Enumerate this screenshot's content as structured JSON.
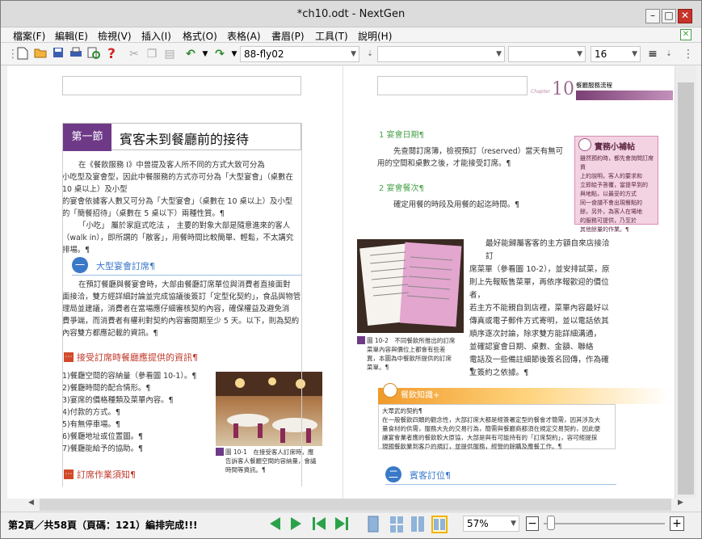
{
  "window": {
    "title": "*ch10.odt - NextGen"
  },
  "menu": [
    "檔案(F)",
    "編輯(E)",
    "檢視(V)",
    "插入(I)",
    "格式(O)",
    "表格(A)",
    "書眉(P)",
    "工具(T)",
    "說明(H)"
  ],
  "toolbar": {
    "style_value": "88-fly02",
    "font_size": "16"
  },
  "status": {
    "text": "第2頁／共58頁（頁碼：121）編排完成!!!",
    "zoom": "57%"
  },
  "left_page": {
    "section_num": "第一節",
    "section_title": "賓客未到餐廳前的接待",
    "para1": [
      "在《餐飲服務 I》中曾提及客人所不同的方式大致可分為",
      "小吃型及宴會型，因此中餐服務的方式亦可分為「大型宴會」（桌數在 10 桌以上）及小型",
      "的宴會依據客人數又可分為「大型宴會」（桌數在 10 桌以上）及小型",
      "的「簡餐招待」（桌數在 5 桌以下）兩種性質。¶",
      "「小吃」 屬於家庭式吃法 ， 主要的對象大部是隨意進來的客人",
      "（walk in），即所謂的「散客」，用餐時間比較簡單、輕鬆，不太講究",
      "排場。¶"
    ],
    "sub1_num": "一",
    "sub1": "大型宴會訂席¶",
    "para2": [
      "在預訂餐廳與餐宴會時，大部由餐廳訂席單位與消費者直接面對",
      "面接洽，雙方經詳細討論並完成協議後簽訂「定型化契約」，食品與物管",
      "理局並建議，消費者在當場應仔細審核契約內容，確保權益及避免消",
      "費爭端，而消費者有權利對契約內容審閱期至少 5 天。以下，則為契約",
      "內容雙方都應記載的資訊。¶"
    ],
    "red1": "接受訂席時餐廳應提供的資訊¶",
    "list": [
      "1)餐廳空間的容納量（參看圖 10-1）。¶",
      "2)餐廳時間的配合情形。¶",
      "3)宴席的價格種類及菜單內容。¶",
      "4)付款的方式。¶",
      "5)有無停車場。¶",
      "6)餐廳地址或位置圖。¶",
      "7)餐廳能給予的協助。¶"
    ],
    "cap1": [
      "圖 10-1　在接受客人訂席時，應",
      "告訴客人餐廳空間的容納量，會議",
      "時間等資訊。¶"
    ],
    "red2": "訂席作業須知¶"
  },
  "right_page": {
    "chapter_label": "Chapter",
    "chapter_num": "10",
    "chapter_name": "餐廳服務流程",
    "g1": "1 宴會日期¶",
    "p1": [
      "先查閱訂席簿，檢視預訂（reserved）當天有無可",
      "用的空間和桌數之後，才能接受訂席。¶"
    ],
    "g2": "2 宴會餐次¶",
    "p2": "確定用餐的時段及用餐的起迄時間。¶",
    "sidebox_title": "實務小補帖",
    "sidebox_text": [
      "雖然預約時，都先會詢問訂席資",
      "上的說明，客人的要求和",
      "立即給予答覆，當提早到的",
      "與地點，以最妥的方式",
      "同一食譜不會出現餐點的",
      "餘，另外，為客人在場地",
      "的服務可提供，乃至於",
      "其他餘量的作業。¶"
    ],
    "p3": [
      "最好能歸屬客客的主方額自來店接洽訂",
      "席菜單（參看圖 10-2），並安排試菜，原",
      "則上先報販售菜單，再依序報歡迎的價位者，",
      "若主方不能親自到店裡，菜單內容最好以",
      "傳真或電子郵件方式寄明，並以電話依其",
      "順序逐次討論，除求雙方能詳細溝通，",
      "並確認宴會日期、桌數、金額、聯絡",
      "電話及一些備註細節後簽名回傳，作為確",
      "立簽約之依據。¶"
    ],
    "cap2": [
      "圖 10-2　不同餐飲所推出的訂席",
      "菜單內容與價位上都會有些差",
      "異，本圖為中餐飲所提供的訂席",
      "菜單。¶"
    ],
    "know_title": "餐飲知識+",
    "know_text": [
      "大眾武的契約¶",
      "在一般餐飲四類的觀念性，大部訂席大都是經簽署定型的餐會才簡需，因其涉及大",
      "量食材的供需，服務大先的交易行為，簡需與餐廳商都須在規定交易契約，因此便",
      "讓宴會業者應的餐飲較大原協，大部是與有可能持有的「訂席契約」，容可經提採",
      "現國餐飲業到客戶的規訂，並提供服務，經營的餘購及應餐工作。¶"
    ],
    "sub2_num": "二",
    "sub2": "賓客訂位¶",
    "pilcrow": "¶"
  }
}
